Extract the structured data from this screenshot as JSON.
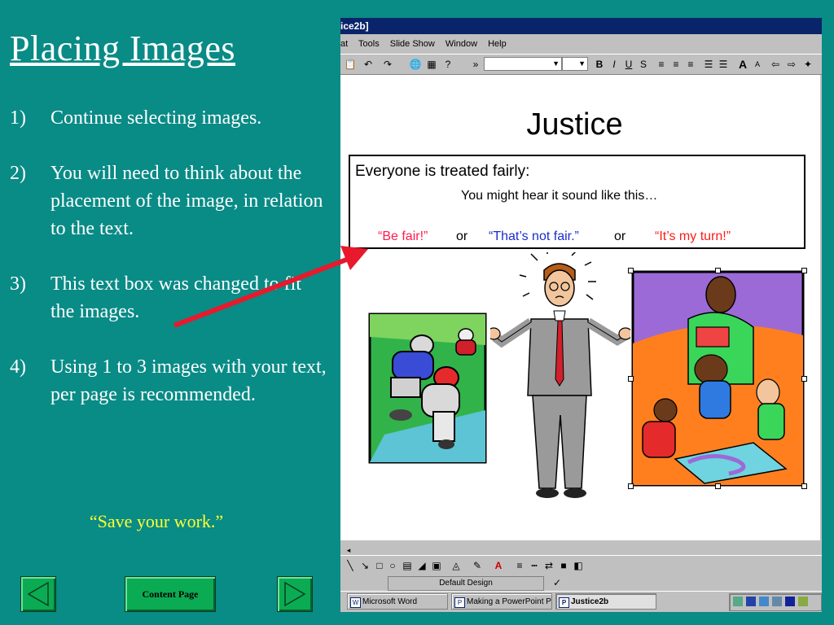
{
  "slide": {
    "title": "Placing Images",
    "steps": [
      {
        "num": "1)",
        "text": "Continue selecting images."
      },
      {
        "num": "2)",
        "text": "You will need to think about the placement of the image, in relation to the text."
      },
      {
        "num": "3)",
        "text": "This text box was changed to fit the images."
      },
      {
        "num": "4)",
        "text": "Using 1 to 3 images with your text, per page is recommended."
      }
    ],
    "save_note": "“Save your work.”",
    "nav": {
      "content_page_label": "Content Page"
    }
  },
  "app": {
    "title": "ice2b]",
    "menu": [
      "at",
      "Tools",
      "Slide Show",
      "Window",
      "Help"
    ],
    "font_combo_value": "",
    "size_combo_value": "",
    "format_buttons": [
      "B",
      "I",
      "U",
      "S"
    ],
    "document": {
      "heading": "Justice",
      "textbox": {
        "line1": "Everyone is treated fairly:",
        "line2": "You might hear it sound like this…",
        "quote1": "“Be fair!”",
        "or1": "or",
        "quote2": "“That’s not fair.”",
        "or2": "or",
        "quote3": "“It’s my turn!”"
      }
    },
    "design_label": "Default Design",
    "taskbar": [
      {
        "label": "Microsoft Word",
        "active": false
      },
      {
        "label": "Making a PowerPoint Page",
        "active": false
      },
      {
        "label": "Justice2b",
        "active": true
      }
    ]
  },
  "colors": {
    "slide_bg": "#098b86",
    "title_text": "#ffffff",
    "save_note": "#ffff33",
    "nav_button": "#0bab53",
    "arrow": "#e8192c",
    "quote1": "#ff1a4a",
    "quote2": "#1a2dcc",
    "quote3": "#ff1a1a"
  }
}
